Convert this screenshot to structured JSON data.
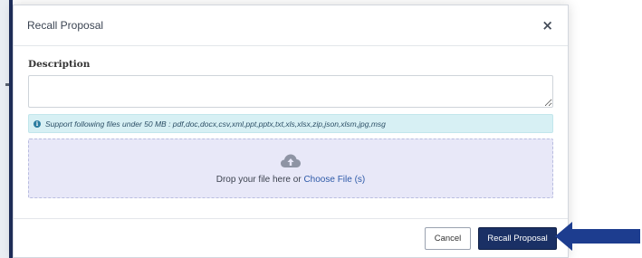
{
  "dialog": {
    "title": "Recall Proposal",
    "close_symbol": "×"
  },
  "description": {
    "label": "Description",
    "value": ""
  },
  "info": {
    "icon": "info-icon",
    "text": "Support following files under 50 MB : pdf,doc,docx,csv,xml,ppt,pptx,txt,xls,xlsx,zip,json,xlsm,jpg,msg"
  },
  "dropzone": {
    "icon": "cloud-upload-icon",
    "prefix": "Drop your file here or ",
    "link": "Choose File (s)"
  },
  "footer": {
    "cancel_label": "Cancel",
    "recall_label": "Recall Proposal"
  },
  "annotation": {
    "icon": "arrow-left-icon",
    "color": "#1d3d8f"
  },
  "colors": {
    "primary": "#1a3065",
    "info_bg": "#d7f0f4",
    "dropzone_bg": "#e8e8f8",
    "link": "#2e5aa8"
  }
}
